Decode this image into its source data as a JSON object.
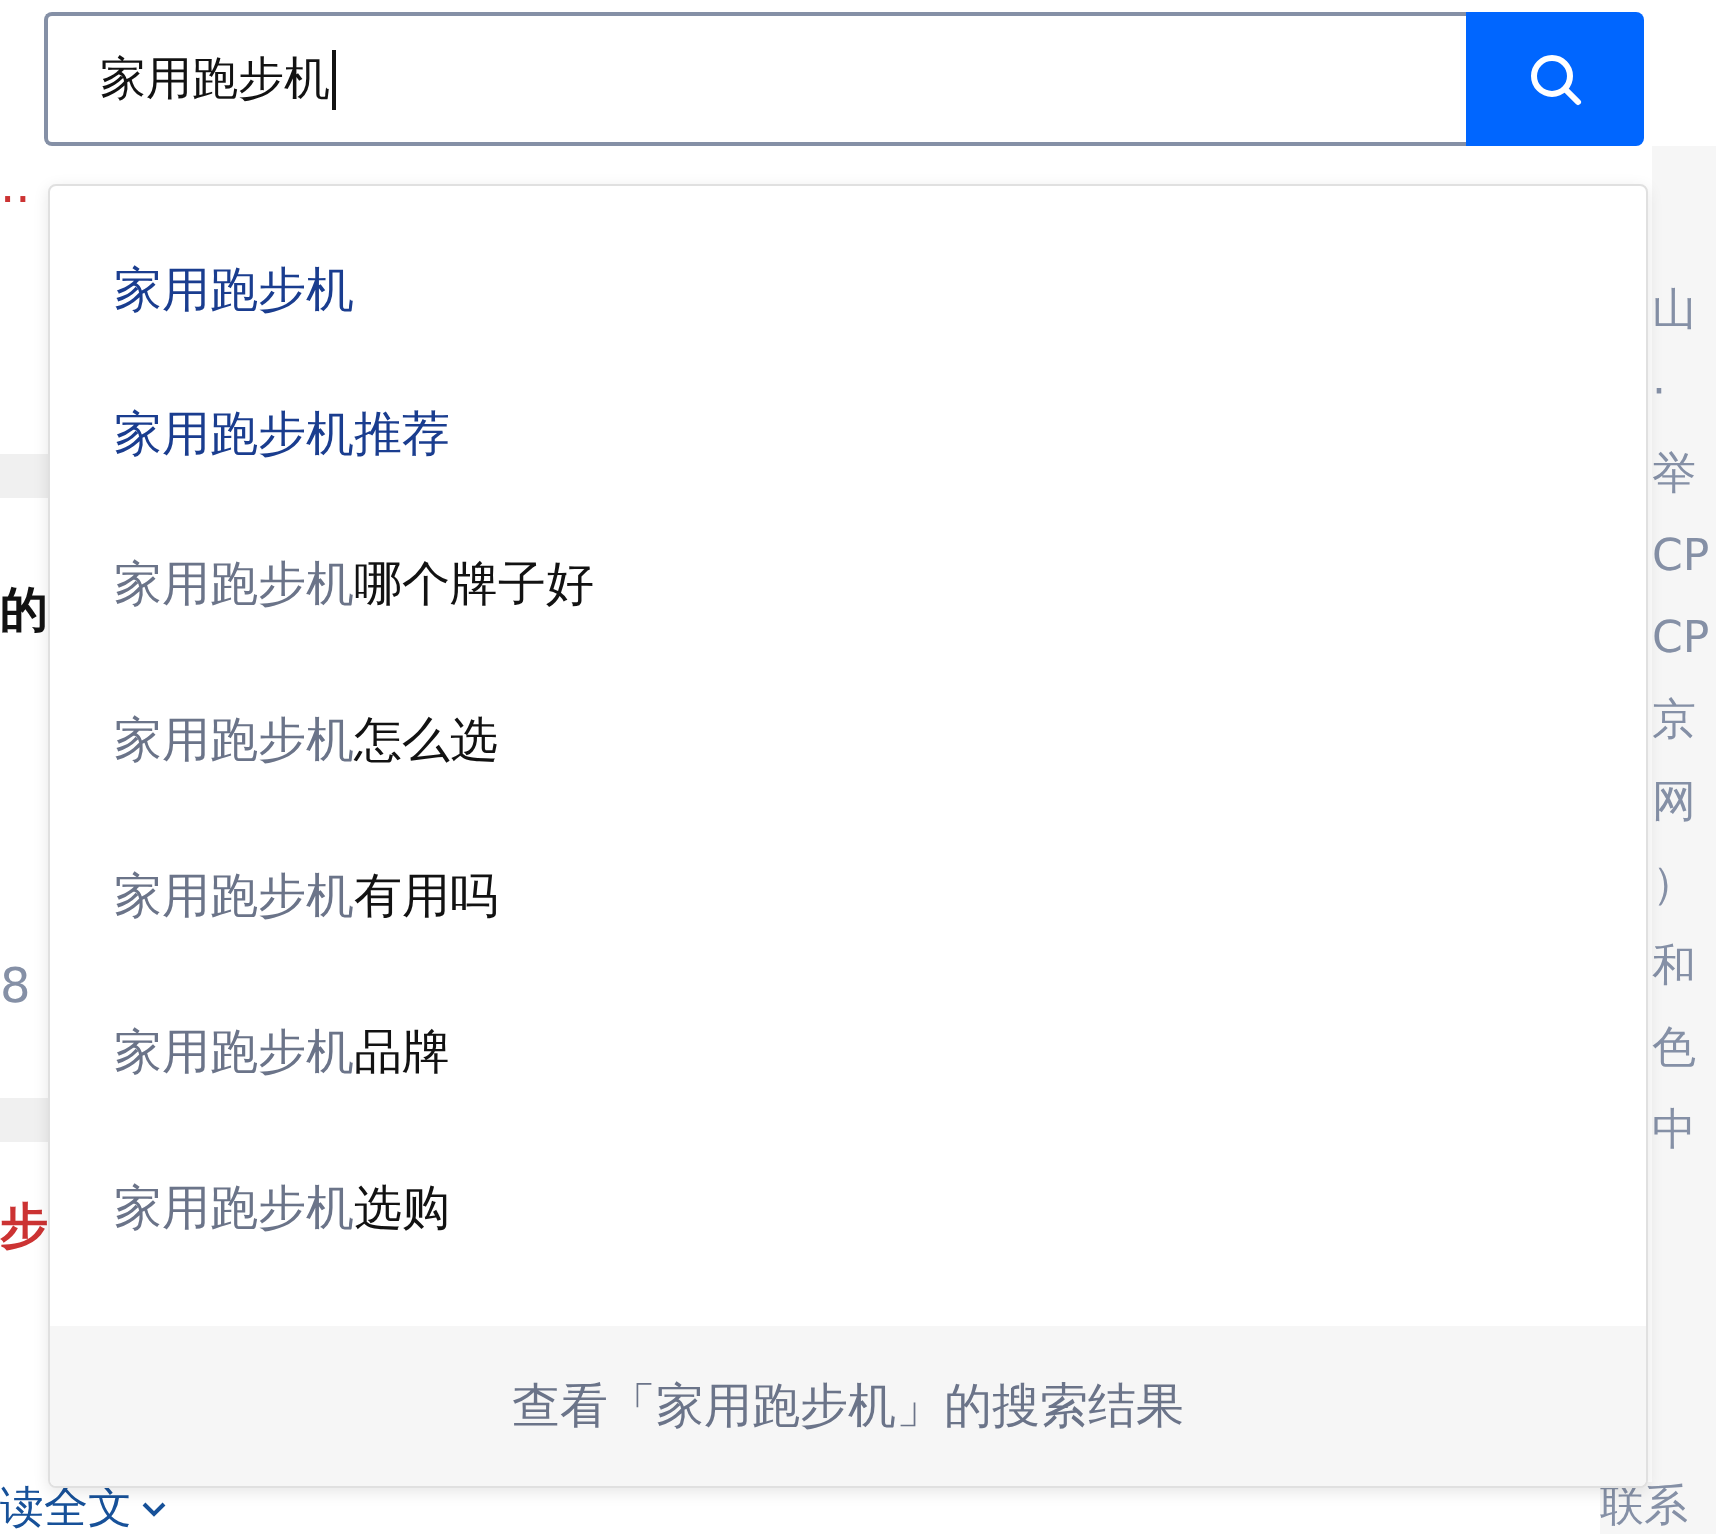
{
  "search": {
    "value": "家用跑步机"
  },
  "background_left": [
    {
      "text": "..",
      "kind": "link"
    },
    {
      "text": "的",
      "kind": "title"
    },
    {
      "text": "8",
      "kind": "meta"
    },
    {
      "text": "步",
      "kind": "title-red"
    },
    {
      "text": "读全文",
      "kind": "more"
    }
  ],
  "background_right": [
    "山",
    "·",
    "举",
    "CP",
    "CP",
    "京",
    "网",
    "）",
    "和",
    "色",
    "中",
    "联系"
  ],
  "suggestions": [
    {
      "match": "家用跑步机",
      "kind": "history"
    },
    {
      "match": "家用跑步机",
      "rest": "推荐",
      "kind": "history"
    },
    {
      "match": "家用跑步机",
      "rest": "哪个牌子好",
      "kind": "suggestion"
    },
    {
      "match": "家用跑步机",
      "rest": "怎么选",
      "kind": "suggestion"
    },
    {
      "match": "家用跑步机",
      "rest": "有用吗",
      "kind": "suggestion"
    },
    {
      "match": "家用跑步机",
      "rest": "品牌",
      "kind": "suggestion"
    },
    {
      "match": "家用跑步机",
      "rest": "选购",
      "kind": "suggestion"
    }
  ],
  "footer": "查看「家用跑步机」的搜索结果"
}
